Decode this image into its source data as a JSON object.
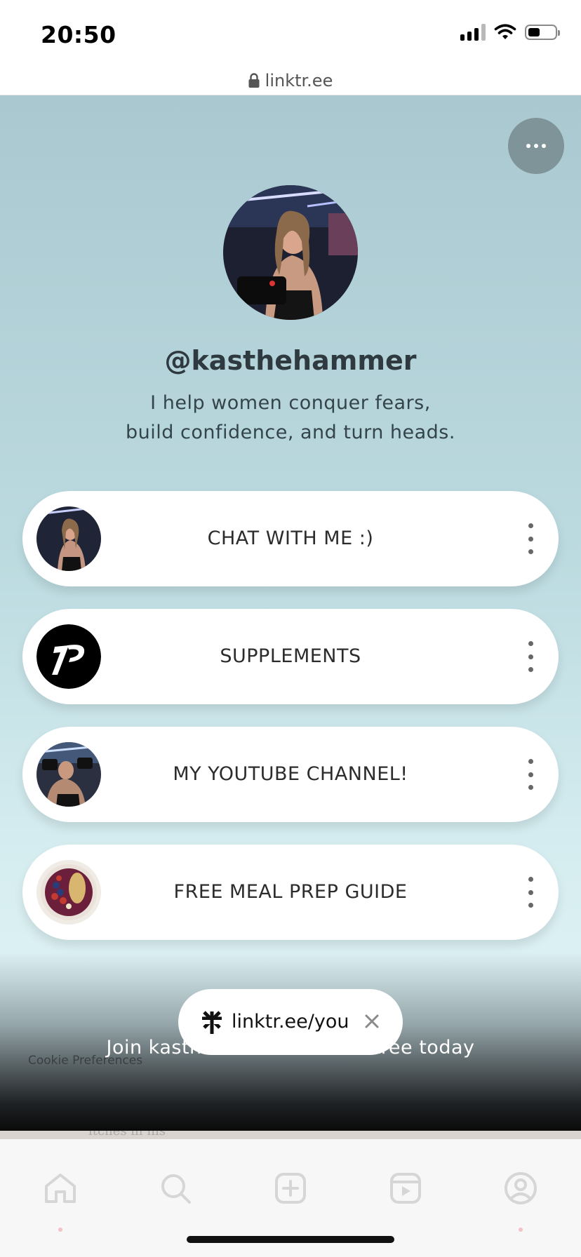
{
  "status_bar": {
    "time": "20:50",
    "icons": [
      "signal-icon",
      "wifi-icon",
      "battery-icon"
    ],
    "battery_level": 0.45
  },
  "browser": {
    "url": "linktr.ee",
    "icon": "lock-icon"
  },
  "profile": {
    "username": "@kasthehammer",
    "bio_lines": [
      "I help women conquer fears,",
      "build confidence, and turn heads."
    ]
  },
  "links": [
    {
      "label": "CHAT WITH ME :)",
      "thumb": "profile-photo"
    },
    {
      "label": "SUPPLEMENTS",
      "thumb": "brand-logo"
    },
    {
      "label": "MY YOUTUBE CHANNEL!",
      "thumb": "gym-photo"
    },
    {
      "label": "FREE MEAL PREP GUIDE",
      "thumb": "smoothie-bowl-photo"
    }
  ],
  "signup_banner": {
    "pill_text": "linktr.ee/you",
    "join_text": "Join kasthehammer on Linktree today",
    "cookie_text": "Cookie Preferences"
  },
  "background_text": "ltches in his",
  "tab_bar": {
    "tabs": [
      "home-icon",
      "search-icon",
      "create-icon",
      "reels-icon",
      "profile-icon"
    ]
  },
  "colors": {
    "page_top": "#aac8d0",
    "page_bottom": "#e2f4f6",
    "card": "#ffffff",
    "more_button": "#7f9499"
  }
}
